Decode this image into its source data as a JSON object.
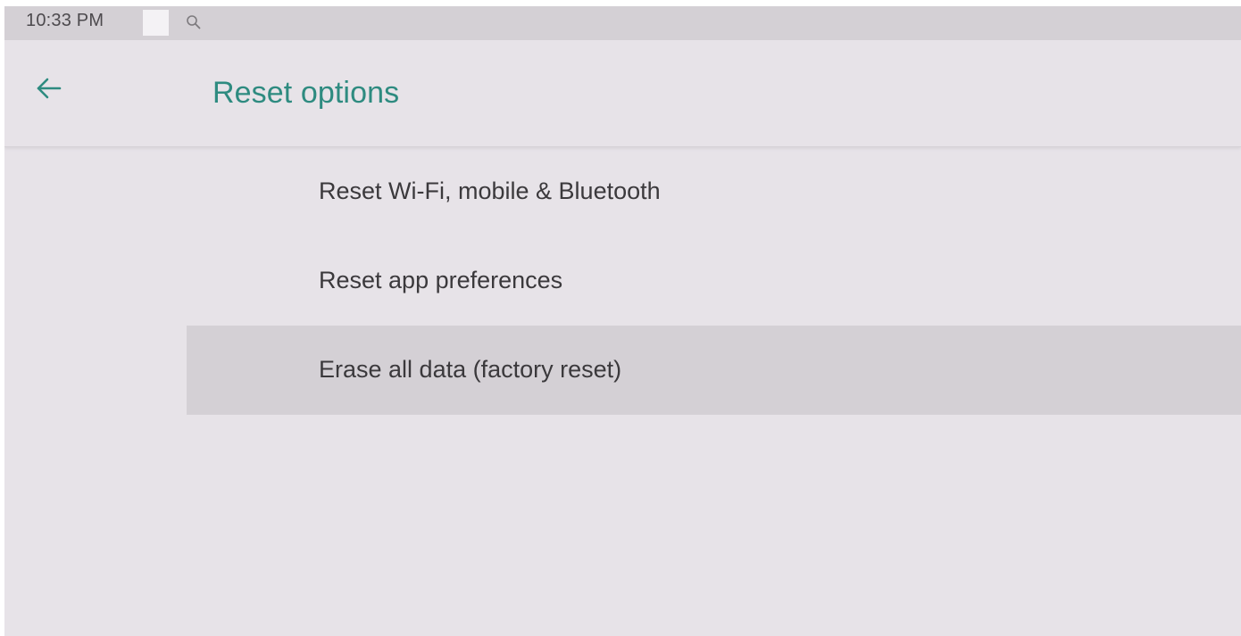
{
  "status_bar": {
    "time": "10:33 PM",
    "icons": [
      "notification-square-icon",
      "search-icon"
    ]
  },
  "app_bar": {
    "back_icon": "arrow-left-icon",
    "title": "Reset options",
    "accent_color": "#2e8b80"
  },
  "reset_options": {
    "items": [
      {
        "label": "Reset Wi-Fi, mobile & Bluetooth",
        "selected": false
      },
      {
        "label": "Reset app preferences",
        "selected": false
      },
      {
        "label": "Erase all data (factory reset)",
        "selected": true
      }
    ]
  }
}
